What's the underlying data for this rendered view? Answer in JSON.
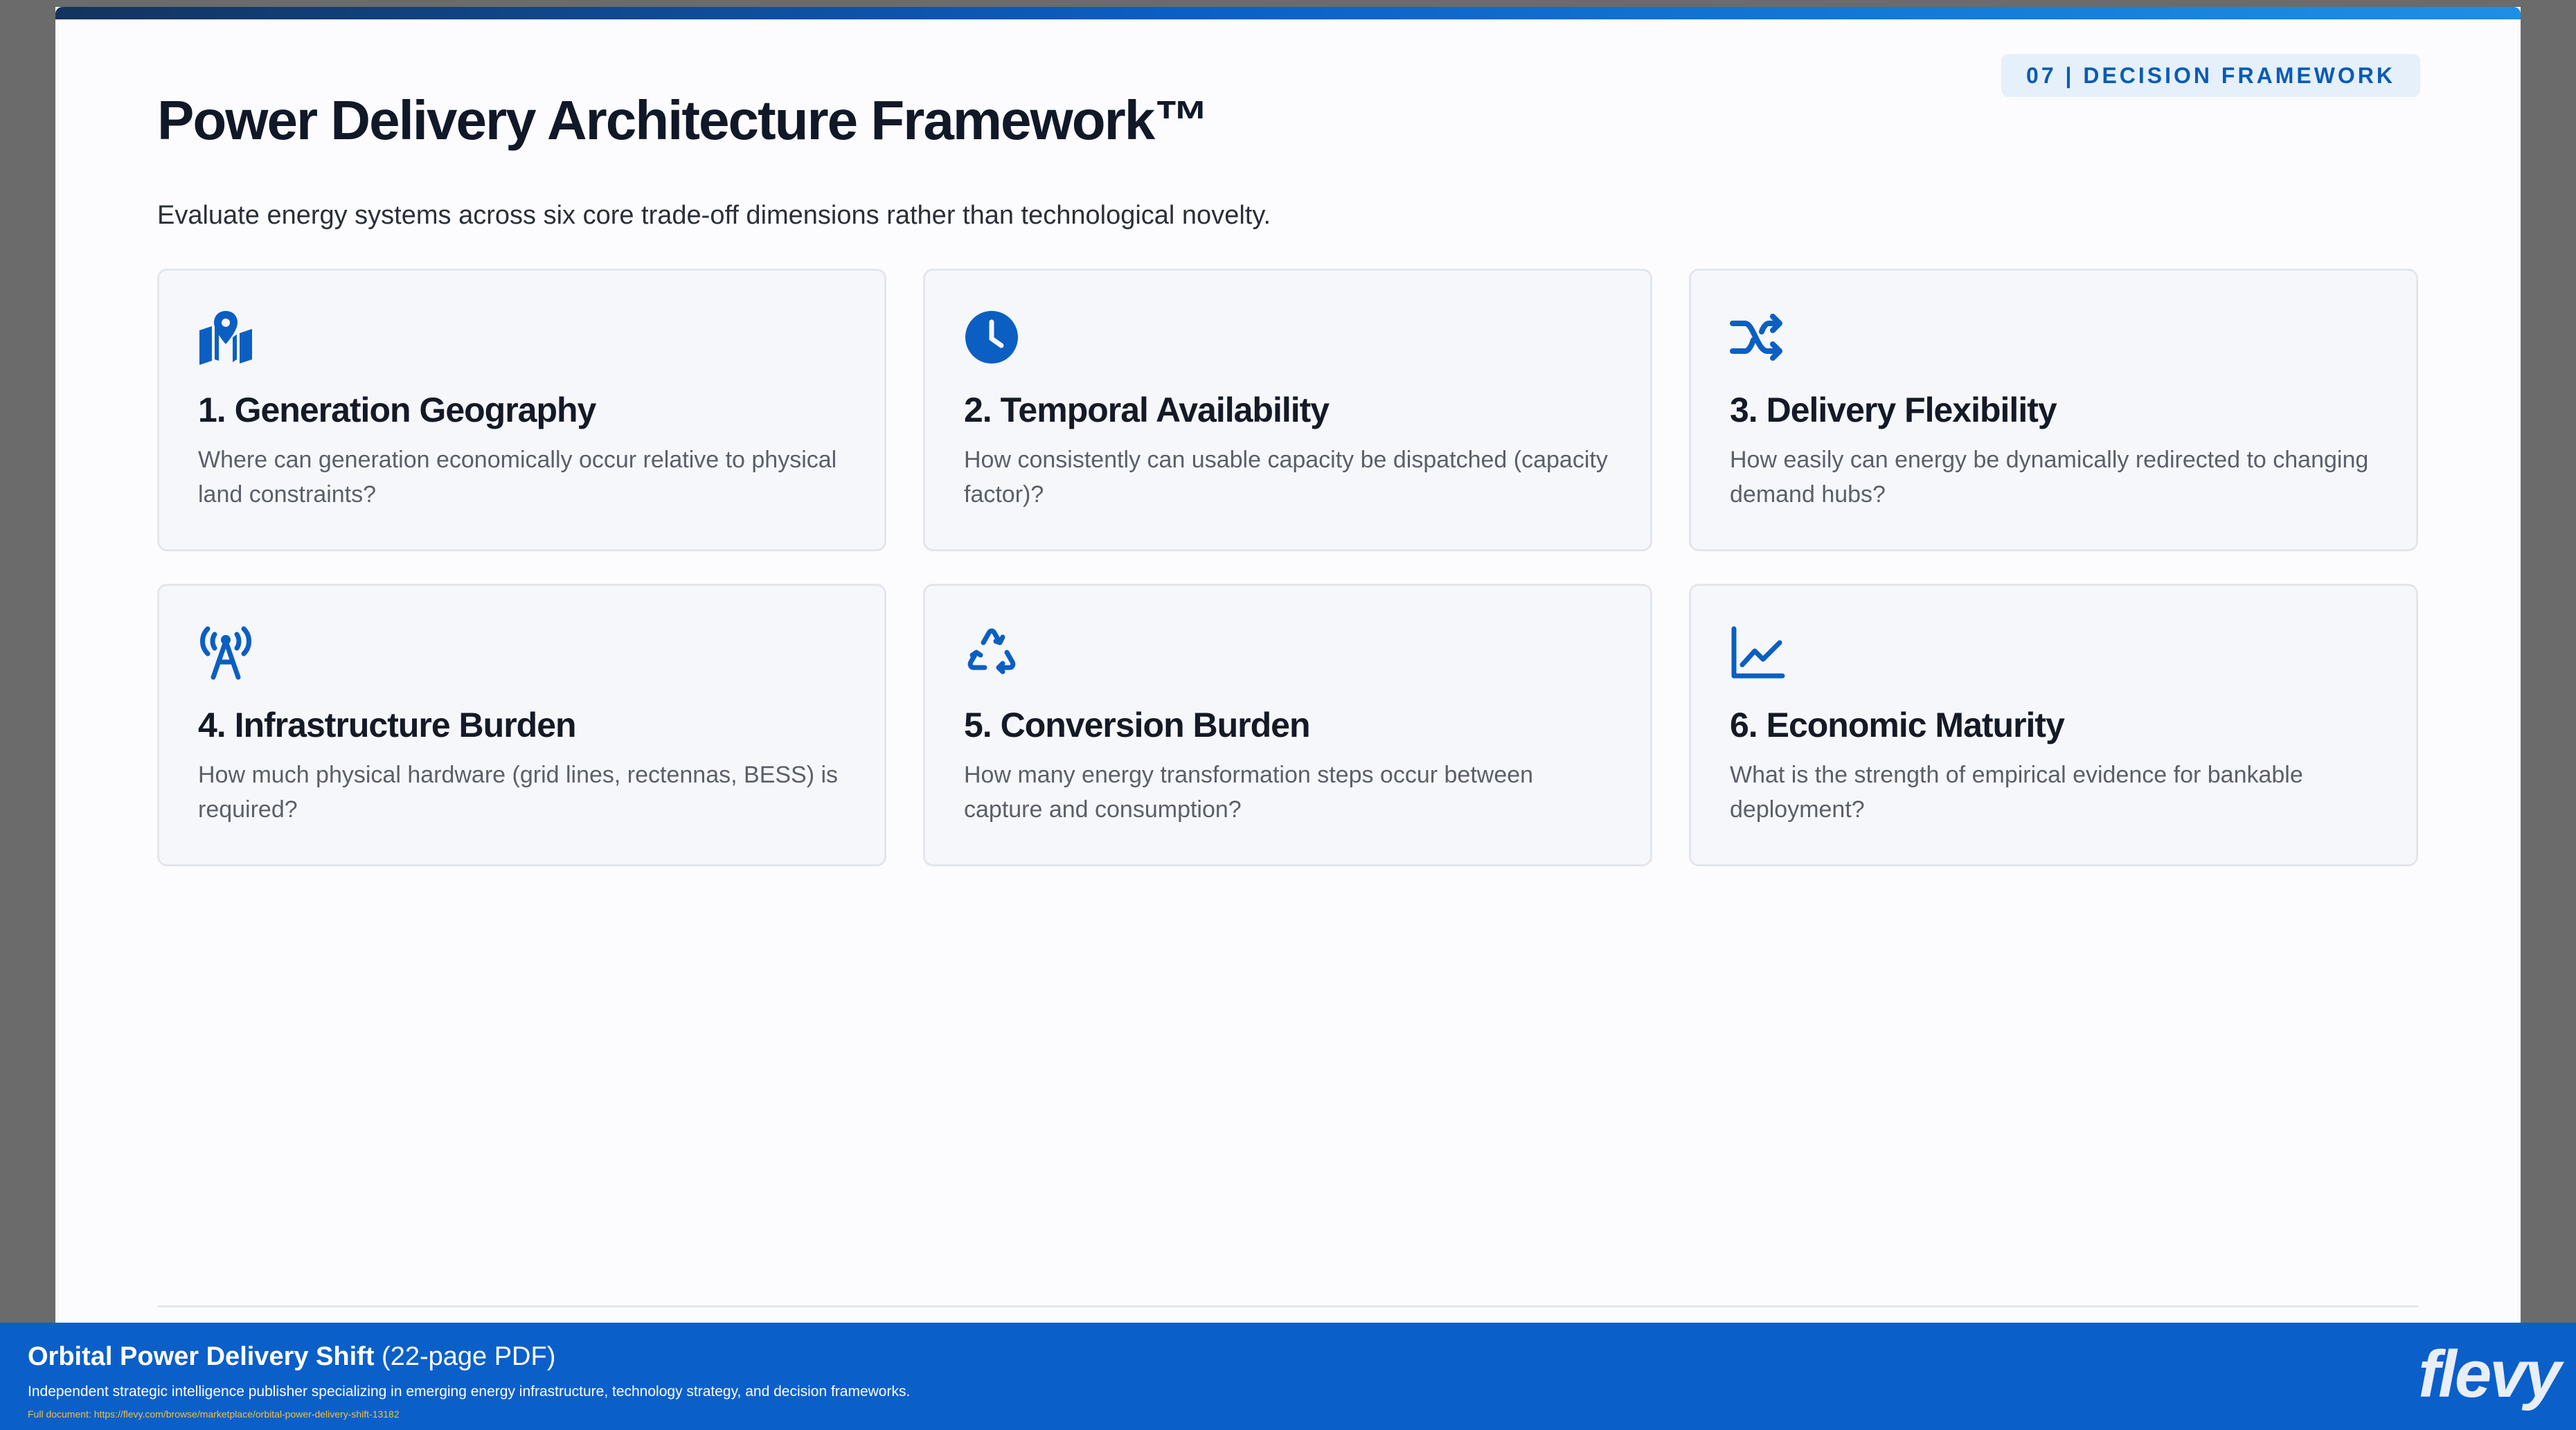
{
  "slide": {
    "badge": "07 | DECISION FRAMEWORK",
    "title": "Power Delivery Architecture Framework™",
    "subtitle": "Evaluate energy systems across six core trade-off dimensions rather than technological novelty."
  },
  "cards": [
    {
      "icon": "map-location-icon",
      "title": "1. Generation Geography",
      "text": "Where can generation economically occur relative to physical land constraints?"
    },
    {
      "icon": "clock-icon",
      "title": "2. Temporal Availability",
      "text": "How consistently can usable capacity be dispatched (capacity factor)?"
    },
    {
      "icon": "shuffle-icon",
      "title": "3. Delivery Flexibility",
      "text": "How easily can energy be dynamically redirected to changing demand hubs?"
    },
    {
      "icon": "tower-broadcast-icon",
      "title": "4. Infrastructure Burden",
      "text": "How much physical hardware (grid lines, rectennas, BESS) is required?"
    },
    {
      "icon": "recycle-icon",
      "title": "5. Conversion Burden",
      "text": "How many energy transformation steps occur between capture and consumption?"
    },
    {
      "icon": "chart-line-icon",
      "title": "6. Economic Maturity",
      "text": "What is the strength of empirical evidence for bankable deployment?"
    }
  ],
  "footer": {
    "title_bold": "Orbital Power Delivery Shift",
    "title_rest": " (22-page PDF)",
    "description": "Independent strategic intelligence publisher specializing in emerging energy infrastructure, technology strategy, and decision frameworks.",
    "link": "Full document: https://flevy.com/browse/marketplace/orbital-power-delivery-shift-13182",
    "logo": "flevy"
  },
  "colors": {
    "accent": "#0b5fc2",
    "footer": "#0b5fc9",
    "badge_bg": "#e5f0fb"
  }
}
